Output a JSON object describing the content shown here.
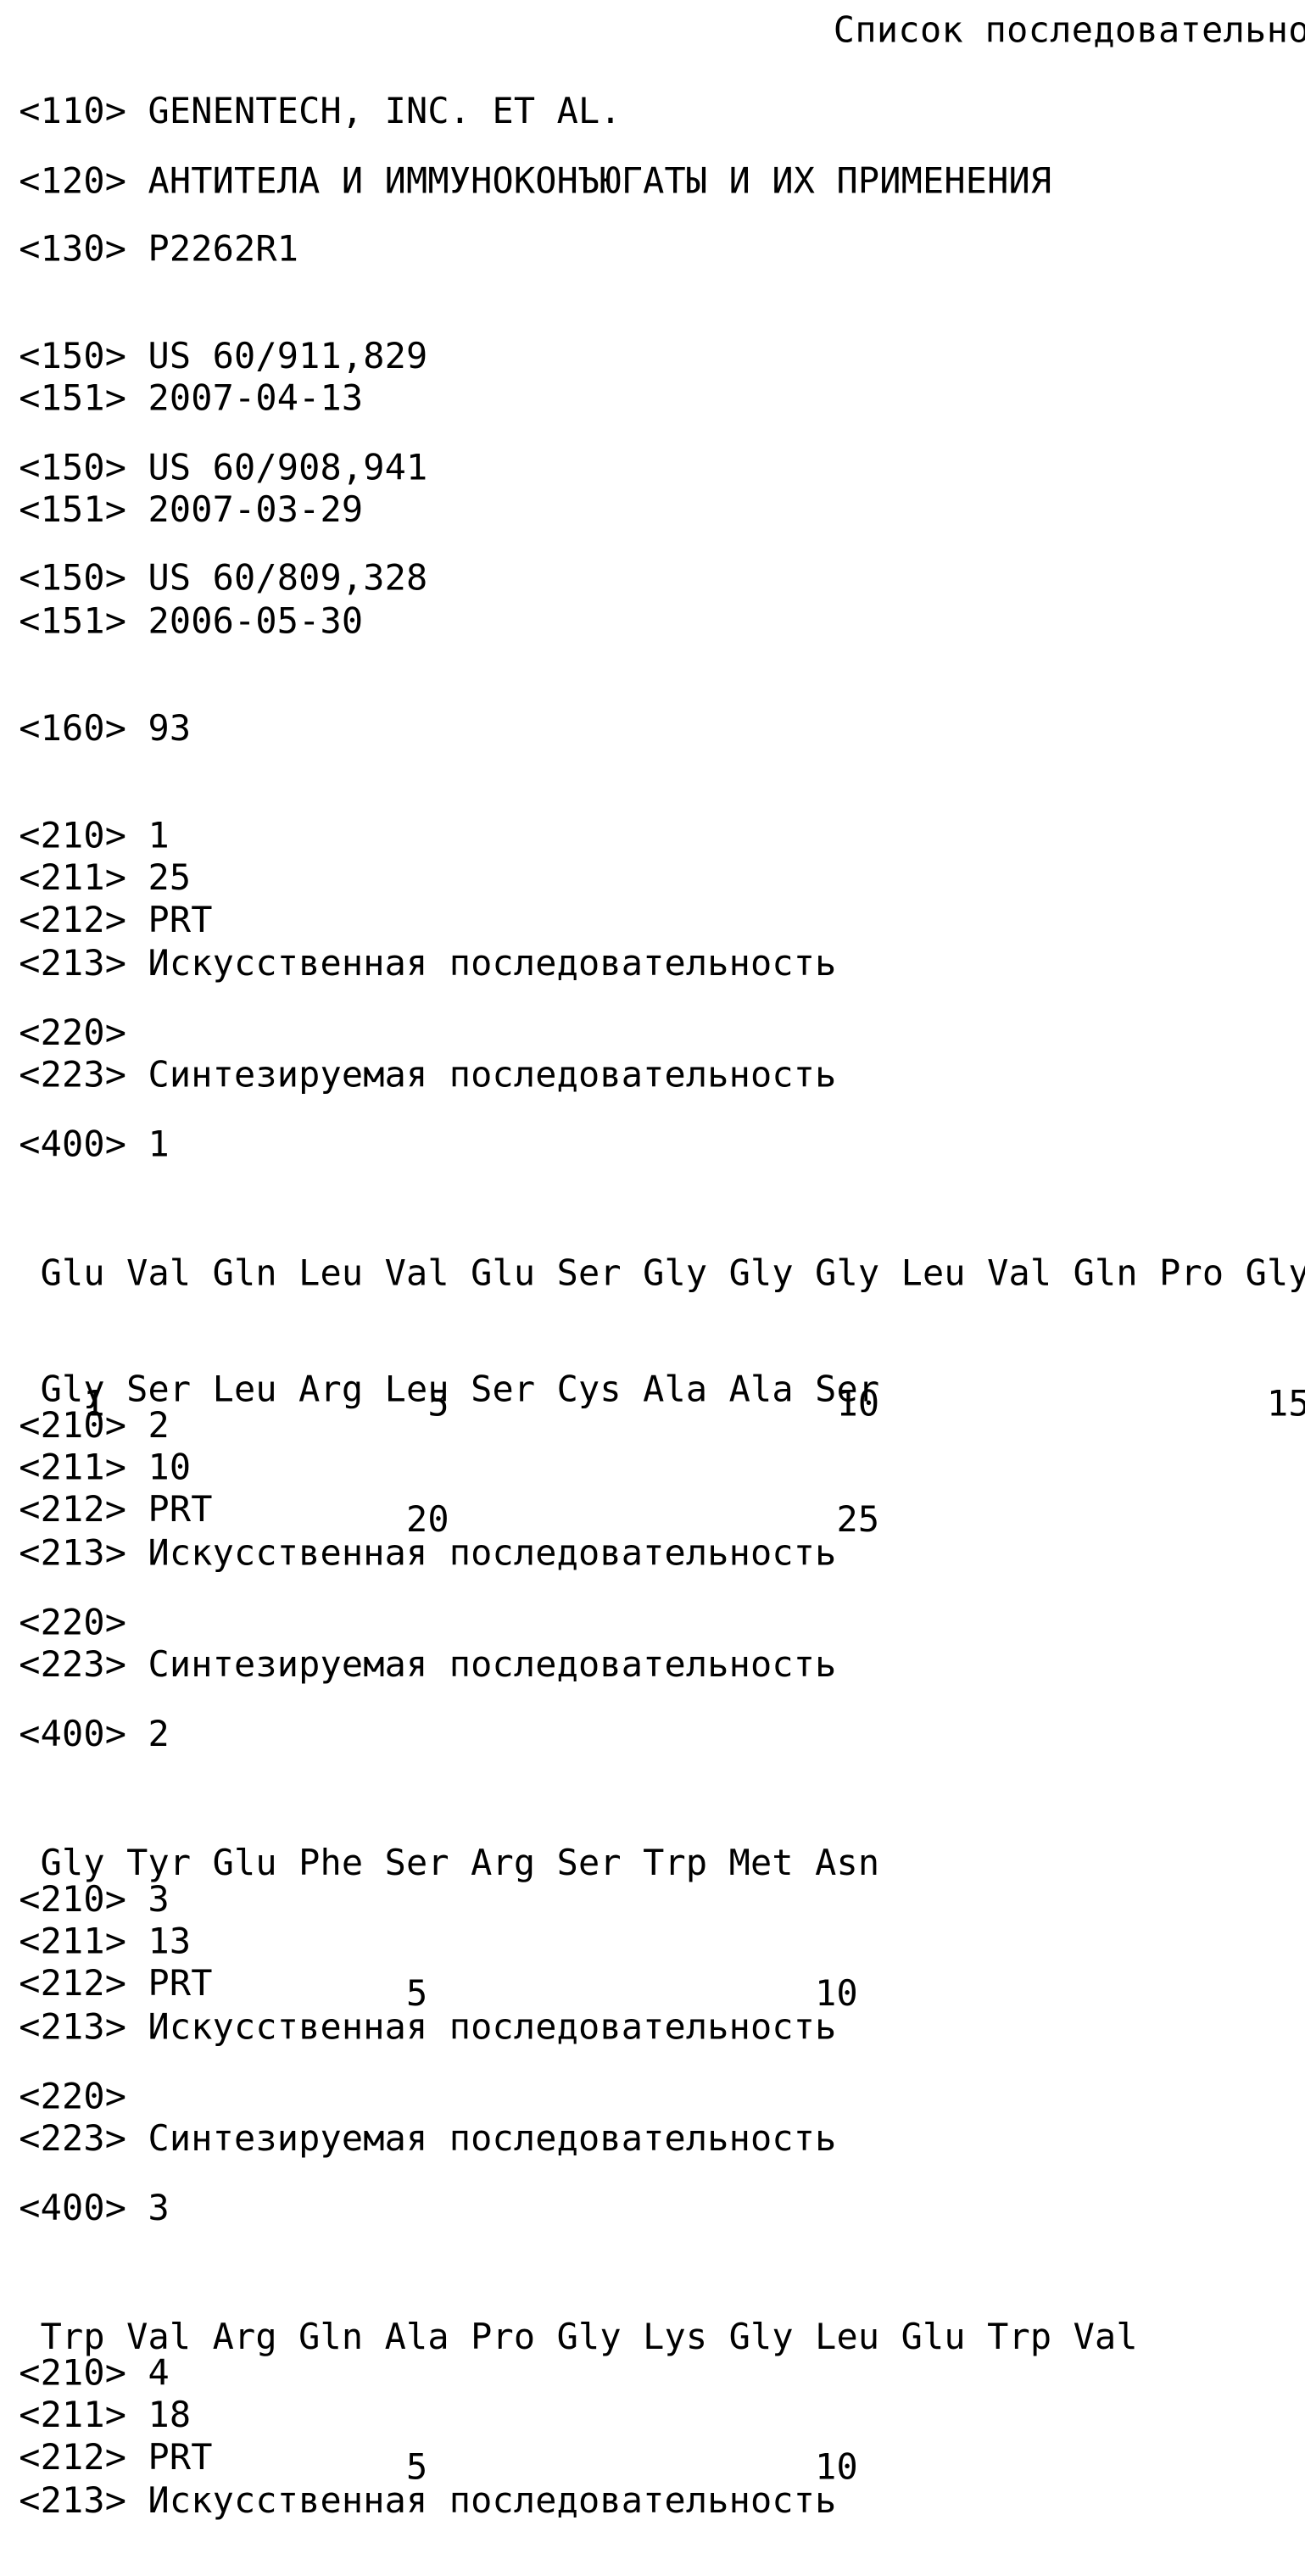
{
  "document": {
    "title": "Список последовательностей",
    "language": "ru"
  },
  "header": {
    "applicant": "<110> GENENTECH, INC. ET AL.",
    "invention_title": "<120> АНТИТЕЛА И ИММУНОКОНЪЮГАТЫ И ИХ ПРИМЕНЕНИЯ",
    "file_reference": "<130> P2262R1",
    "priority_1_number": "<150> US 60/911,829",
    "priority_1_date": "<151> 2007-04-13",
    "priority_2_number": "<150> US 60/908,941",
    "priority_2_date": "<151> 2007-03-29",
    "priority_3_number": "<150> US 60/809,328",
    "priority_3_date": "<151> 2006-05-30",
    "number_of_seqs": "<160> 93"
  },
  "sequences": [
    {
      "seq_id": "<210> 1",
      "length": "<211> 25",
      "type": "<212> PRT",
      "organism": "<213> Искусственная последовательность",
      "feature": "<220>",
      "other_info": "<223> Синтезируемая последовательность",
      "seq_header": "<400> 1",
      "residue_lines": [
        " Glu Val Gln Leu Val Glu Ser Gly Gly Gly Leu Val Gln Pro Gly",
        " Gly Ser Leu Arg Leu Ser Cys Ala Ala Ser"
      ],
      "number_lines": [
        "   1               5                  10                  15",
        "                  20                  25"
      ]
    },
    {
      "seq_id": "<210> 2",
      "length": "<211> 10",
      "type": "<212> PRT",
      "organism": "<213> Искусственная последовательность",
      "feature": "<220>",
      "other_info": "<223> Синтезируемая последовательность",
      "seq_header": "<400> 2",
      "residue_lines": [
        " Gly Tyr Glu Phe Ser Arg Ser Trp Met Asn"
      ],
      "number_lines": [
        "                  5                  10"
      ]
    },
    {
      "seq_id": "<210> 3",
      "length": "<211> 13",
      "type": "<212> PRT",
      "organism": "<213> Искусственная последовательность",
      "feature": "<220>",
      "other_info": "<223> Синтезируемая последовательность",
      "seq_header": "<400> 3",
      "residue_lines": [
        " Trp Val Arg Gln Ala Pro Gly Lys Gly Leu Glu Trp Val"
      ],
      "number_lines": [
        "                  5                  10"
      ]
    },
    {
      "seq_id": "<210> 4",
      "length": "<211> 18",
      "type": "<212> PRT",
      "organism": "<213> Искусственная последовательность"
    }
  ]
}
